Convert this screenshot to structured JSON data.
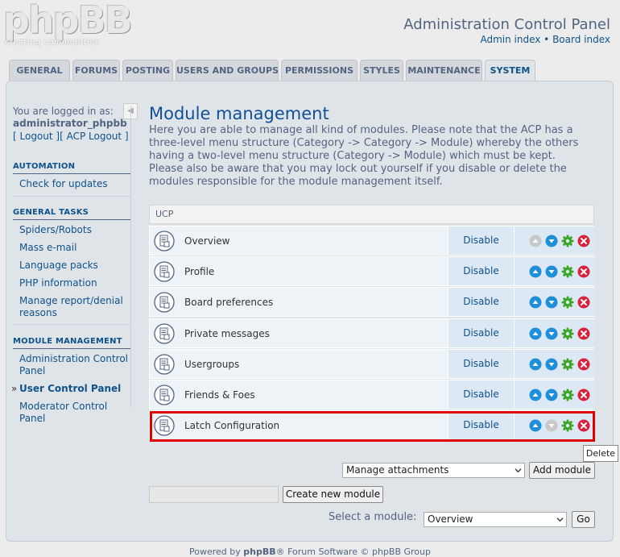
{
  "header": {
    "logo_text": "phpBB",
    "logo_registered": "®",
    "logo_tagline": "creating communities",
    "title": "Administration Control Panel",
    "links": {
      "admin_index": "Admin index",
      "separator": "•",
      "board_index": "Board index"
    }
  },
  "tabs": [
    {
      "label": "GENERAL"
    },
    {
      "label": "FORUMS"
    },
    {
      "label": "POSTING"
    },
    {
      "label": "USERS AND GROUPS"
    },
    {
      "label": "PERMISSIONS"
    },
    {
      "label": "STYLES"
    },
    {
      "label": "MAINTENANCE"
    },
    {
      "label": "SYSTEM",
      "active": true
    }
  ],
  "sidebar": {
    "logged_in_label": "You are logged in as:",
    "username": "administrator_phpbb",
    "logout_prefix": "[ ",
    "logout": "Logout",
    "bracket_mid": " ][ ",
    "acp_logout": "ACP Logout",
    "logout_suffix": " ]",
    "collapse_icon": "◀",
    "sections": [
      {
        "heading": "AUTOMATION",
        "items": [
          "Check for updates"
        ]
      },
      {
        "heading": "GENERAL TASKS",
        "items": [
          "Spiders/Robots",
          "Mass e-mail",
          "Language packs",
          "PHP information",
          "Manage report/denial reasons"
        ]
      },
      {
        "heading": "MODULE MANAGEMENT",
        "items": [
          "Administration Control Panel",
          "User Control Panel",
          "Moderator Control Panel"
        ],
        "active": "User Control Panel"
      }
    ]
  },
  "main": {
    "title": "Module management",
    "description": "Here you are able to manage all kind of modules. Please note that the ACP has a three-level menu structure (Category -> Category -> Module) whereby the others having a two-level menu structure (Category -> Module) which must be kept. Please also be aware that you may lock out yourself if you disable or delete the modules responsible for the module management itself.",
    "category": "UCP",
    "modules": [
      {
        "name": "Overview",
        "action": "Disable",
        "up_enabled": false,
        "down_enabled": true
      },
      {
        "name": "Profile",
        "action": "Disable",
        "up_enabled": true,
        "down_enabled": true
      },
      {
        "name": "Board preferences",
        "action": "Disable",
        "up_enabled": true,
        "down_enabled": true
      },
      {
        "name": "Private messages",
        "action": "Disable",
        "up_enabled": true,
        "down_enabled": true
      },
      {
        "name": "Usergroups",
        "action": "Disable",
        "up_enabled": true,
        "down_enabled": true
      },
      {
        "name": "Friends & Foes",
        "action": "Disable",
        "up_enabled": true,
        "down_enabled": true
      },
      {
        "name": "Latch Configuration",
        "action": "Disable",
        "up_enabled": true,
        "down_enabled": false
      }
    ],
    "tooltip": "Delete",
    "add_module": {
      "selected": "Manage attachments",
      "button": "Add module"
    },
    "create_module": {
      "value": "",
      "button": "Create new module"
    },
    "select_module": {
      "label": "Select a module:",
      "selected": "Overview",
      "button": "Go"
    }
  },
  "footer": {
    "prefix": "Powered by ",
    "brand": "phpBB",
    "suffix": "® Forum Software © phpBB Group"
  },
  "colors": {
    "accent": "#105289",
    "up_down": "#1e8fd8",
    "gear": "#3aa526",
    "delete": "#d9213b",
    "highlight": "#e00000"
  }
}
